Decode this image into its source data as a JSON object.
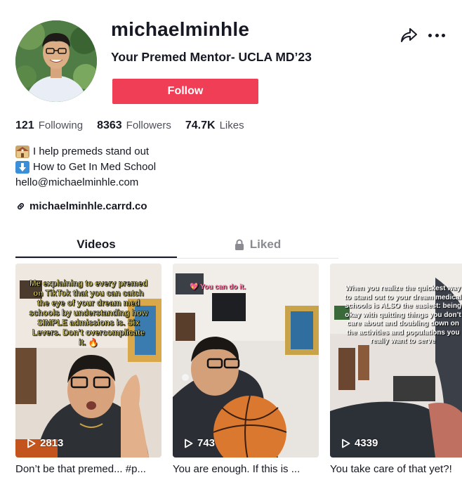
{
  "profile": {
    "username": "michaelminhle",
    "subtitle": "Your Premed Mentor- UCLA MD’23",
    "follow_label": "Follow"
  },
  "header_icons": [
    "share-icon",
    "more-icon"
  ],
  "stats": [
    {
      "value": "121",
      "label": "Following"
    },
    {
      "value": "8363",
      "label": "Followers"
    },
    {
      "value": "74.7K",
      "label": "Likes"
    }
  ],
  "bio": {
    "line1": "I help premeds stand out",
    "line2": "How to Get In Med School",
    "line3": "hello@michaelminhle.com",
    "line1_icon": "school-emoji",
    "line2_icon": "down-arrow-emoji"
  },
  "link": {
    "text": "michaelminhle.carrd.co",
    "icon": "link-icon"
  },
  "tabs": [
    {
      "label": "Videos",
      "active": true
    },
    {
      "label": "Liked",
      "active": false,
      "icon": "lock-icon"
    }
  ],
  "videos": [
    {
      "overlay": "Me explaining to every premed on TikTok that you can catch the eye of your dream med schools by understanding how SIMPLE admissions is. Six Levers. Don’t overcomplicate it. 🔥",
      "views": "2813",
      "caption": "Don’t be that premed... #p..."
    },
    {
      "overlay": "💖 You can do it.",
      "views": "743",
      "caption": "You are enough. If this is ..."
    },
    {
      "overlay": "When you realize the quickest way to stand out to your dream medical schools is ALSO the easiest: being okay with quitting things you don’t care about and doubling down on the activities and populations you really want to serve",
      "views": "4339",
      "caption": "You take care of that yet?!"
    }
  ],
  "colors": {
    "accent": "#ef3e55",
    "text": "#161823",
    "muted": "#8a8b91"
  }
}
